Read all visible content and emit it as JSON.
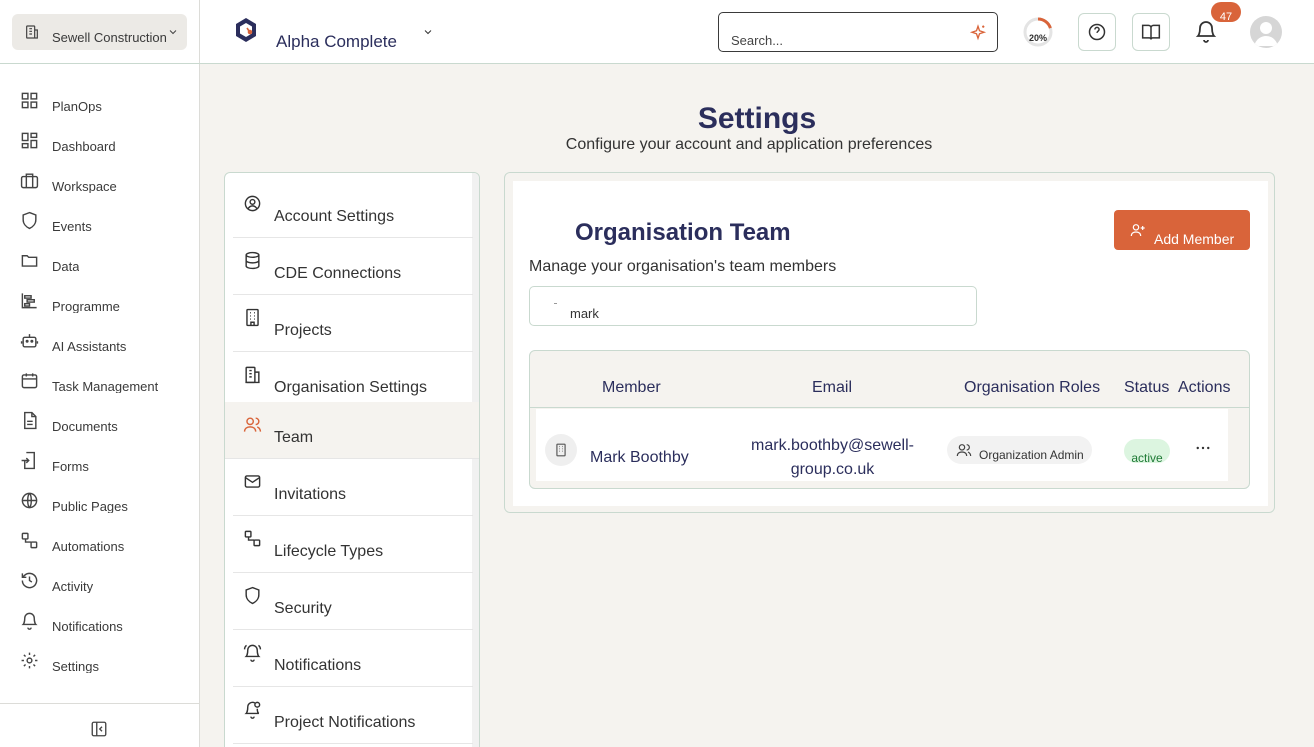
{
  "sidebar": {
    "org_name": "Sewell Construction",
    "items": [
      {
        "label": "PlanOps",
        "icon": "grid-icon"
      },
      {
        "label": "Dashboard",
        "icon": "dashboard-icon"
      },
      {
        "label": "Workspace",
        "icon": "briefcase-icon"
      },
      {
        "label": "Events",
        "icon": "shield-icon"
      },
      {
        "label": "Data",
        "icon": "folder-icon"
      },
      {
        "label": "Programme",
        "icon": "gantt-icon"
      },
      {
        "label": "AI Assistants",
        "icon": "robot-icon"
      },
      {
        "label": "Task Management",
        "icon": "calendar-icon"
      },
      {
        "label": "Documents",
        "icon": "document-icon"
      },
      {
        "label": "Forms",
        "icon": "form-icon"
      },
      {
        "label": "Public Pages",
        "icon": "globe-icon"
      },
      {
        "label": "Automations",
        "icon": "workflow-icon"
      },
      {
        "label": "Activity",
        "icon": "history-icon"
      },
      {
        "label": "Notifications",
        "icon": "bell-icon"
      },
      {
        "label": "Settings",
        "icon": "gear-icon"
      }
    ]
  },
  "topbar": {
    "project_name": "Alpha Complete",
    "search_placeholder": "Search...",
    "progress_percent": 20,
    "progress_label": "20%",
    "notification_count": "47"
  },
  "page": {
    "title": "Settings",
    "subtitle": "Configure your account and application preferences"
  },
  "settings_menu": {
    "items": [
      {
        "label": "Account Settings",
        "icon": "user-circle-icon"
      },
      {
        "label": "CDE Connections",
        "icon": "database-icon"
      },
      {
        "label": "Projects",
        "icon": "building-icon"
      },
      {
        "label": "Organisation Settings",
        "icon": "office-icon"
      },
      {
        "label": "Team",
        "icon": "users-icon"
      },
      {
        "label": "Invitations",
        "icon": "mail-icon"
      },
      {
        "label": "Lifecycle Types",
        "icon": "workflow-icon"
      },
      {
        "label": "Security",
        "icon": "shield-icon"
      },
      {
        "label": "Notifications",
        "icon": "bell-ring-icon"
      },
      {
        "label": "Project Notifications",
        "icon": "bell-plus-icon"
      }
    ]
  },
  "team": {
    "title": "Organisation Team",
    "subtitle": "Manage your organisation's team members",
    "add_member_label": "Add Member",
    "search_value": "mark",
    "columns": {
      "member": "Member",
      "email": "Email",
      "roles": "Organisation Roles",
      "status": "Status",
      "actions": "Actions"
    },
    "rows": [
      {
        "member": "Mark Boothby",
        "email_line1": "mark.boothby@sewell-",
        "email_line2": "group.co.uk",
        "role": "Organization Admin",
        "status": "active",
        "actions": "···"
      }
    ]
  },
  "colors": {
    "brand_navy": "#2b2e5c",
    "accent_orange": "#d9643a",
    "border_green": "#c9d9cf",
    "background": "#f5f3ef"
  }
}
